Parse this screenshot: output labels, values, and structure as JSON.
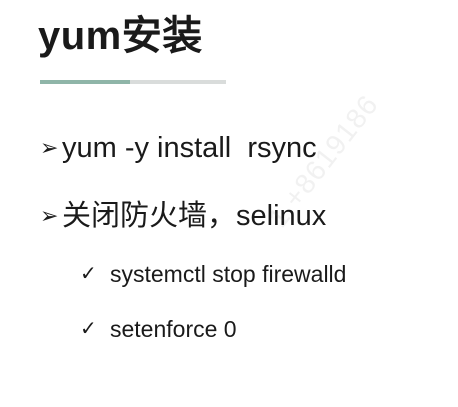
{
  "slide": {
    "title": "yum安装",
    "bullets": [
      {
        "marker": "➢",
        "text": "yum -y install  rsync"
      },
      {
        "marker": "➢",
        "text": "关闭防火墙，selinux"
      }
    ],
    "subitems": [
      {
        "marker": "✓",
        "text": "systemctl stop firewalld"
      },
      {
        "marker": "✓",
        "text": "setenforce 0"
      }
    ],
    "watermark": "1 +8619186"
  },
  "colors": {
    "underline_accent": "#8fb5a8",
    "underline_rest": "#d9dcdb",
    "text": "#1a1a1a"
  }
}
